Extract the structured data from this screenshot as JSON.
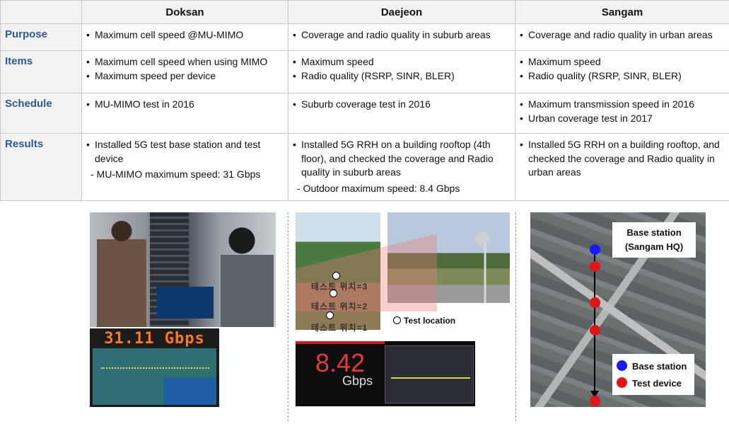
{
  "table": {
    "columns": [
      "Doksan",
      "Daejeon",
      "Sangam"
    ],
    "rows": [
      {
        "label": "Purpose",
        "doksan": [
          "Maximum cell speed @MU-MIMO"
        ],
        "daejeon": [
          "Coverage and radio quality in suburb areas"
        ],
        "sangam": [
          "Coverage and radio quality in urban areas"
        ]
      },
      {
        "label": "Items",
        "doksan": [
          "Maximum cell speed when using MIMO",
          "Maximum speed per device"
        ],
        "daejeon": [
          "Maximum speed",
          "Radio quality (RSRP, SINR, BLER)"
        ],
        "sangam": [
          "Maximum speed",
          "Radio quality (RSRP, SINR, BLER)"
        ]
      },
      {
        "label": "Schedule",
        "doksan": [
          "MU-MIMO test in 2016"
        ],
        "daejeon": [
          "Suburb coverage test in 2016"
        ],
        "sangam": [
          "Maximum transmission speed in 2016",
          "Urban coverage test in 2017"
        ]
      },
      {
        "label": "Results",
        "doksan": [
          "Installed 5G test base station and test device"
        ],
        "doksan_sub": "- MU-MIMO maximum speed: 31 Gbps",
        "daejeon": [
          "Installed 5G RRH on a building rooftop (4th floor), and checked the coverage and Radio quality in suburb areas"
        ],
        "daejeon_sub": "- Outdoor maximum speed: 8.4 Gbps",
        "sangam": [
          "Installed 5G RRH on a building rooftop, and checked the coverage and Radio quality in urban areas"
        ]
      }
    ]
  },
  "figures": {
    "doksan_speed": "31.11  Gbps",
    "daejeon_speed": "8.42",
    "daejeon_unit": "Gbps",
    "test_location_legend": "Test location",
    "korean_labels": [
      "테스트 위치=3",
      "테스트 위치=2",
      "테스트 위치=1"
    ],
    "map_callout_line1": "Base station",
    "map_callout_line2": "(Sangam HQ)",
    "legend_base_station": "Base station",
    "legend_test_device": "Test device",
    "colors": {
      "base_station": "#1a1aff",
      "test_device": "#e01515",
      "speed_orange": "#ff7a1a",
      "speed_red": "#e23a3a"
    }
  }
}
